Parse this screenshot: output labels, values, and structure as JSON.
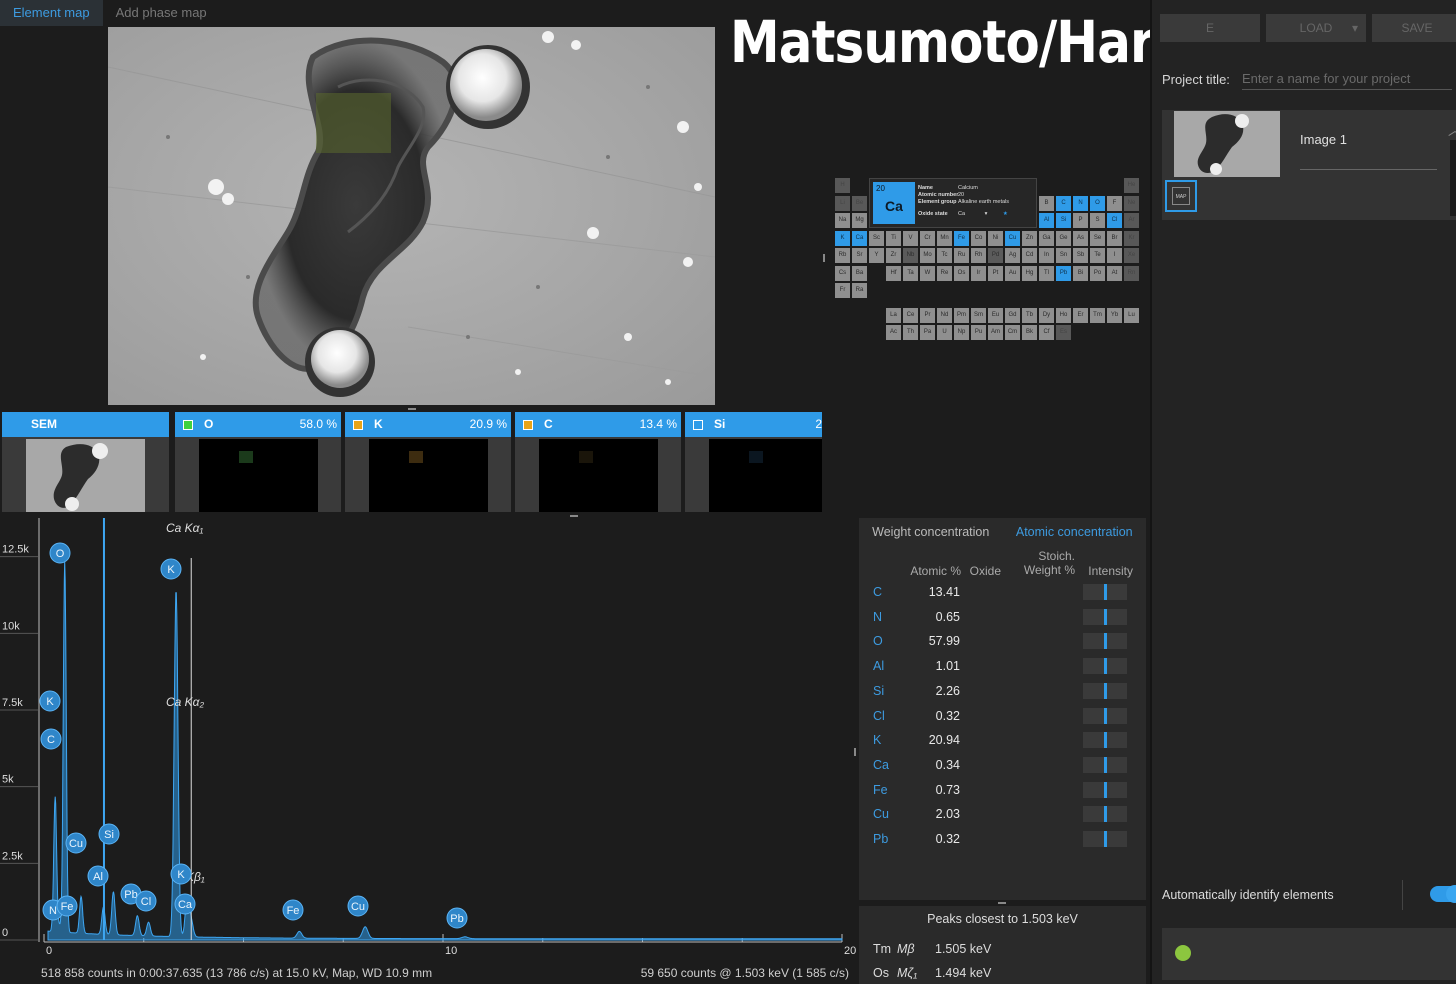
{
  "tabs": [
    "Element map",
    "Add phase map"
  ],
  "overlay_title": "Matsumoto/Harris/Greenyer",
  "periodic_table": {
    "tooltip": {
      "number": "20",
      "symbol": "Ca",
      "rows": [
        {
          "label": "Name",
          "value": "Calcium"
        },
        {
          "label": "Atomic number",
          "value": "20"
        },
        {
          "label": "Element group",
          "value": "Alkaline earth metals"
        },
        {
          "label": "Oxide state",
          "value": "Ca"
        }
      ]
    },
    "selected": [
      "C",
      "N",
      "O",
      "Al",
      "Si",
      "Cl",
      "K",
      "Ca",
      "Fe",
      "Cu",
      "Pb"
    ]
  },
  "tiles": [
    {
      "name": "SEM",
      "percent": "",
      "swatch": ""
    },
    {
      "name": "O",
      "percent": "58.0 %",
      "swatch": "#3fd13f"
    },
    {
      "name": "K",
      "percent": "20.9 %",
      "swatch": "#e8a317"
    },
    {
      "name": "C",
      "percent": "13.4 %",
      "swatch": "#e8a317"
    },
    {
      "name": "Si",
      "percent": "2",
      "swatch": "#2f9be8"
    }
  ],
  "spectrum": {
    "y_ticks": [
      "12.5k",
      "10k",
      "7.5k",
      "5k",
      "2.5k",
      "0"
    ],
    "x_ticks": [
      "0",
      "10",
      "20"
    ],
    "line_labels": [
      {
        "text": "Ca Kα₁"
      },
      {
        "text": "Ca Kα₂"
      },
      {
        "text": "a Kβ₁"
      }
    ],
    "peak_markers": [
      "O",
      "K",
      "K",
      "C",
      "Cu",
      "Si",
      "Al",
      "Pb",
      "Cl",
      "K",
      "Ca",
      "N",
      "Fe",
      "Fe",
      "Cu",
      "Pb"
    ],
    "status_left": "518 858 counts in 0:00:37.635 (13 786 c/s) at 15.0 kV, Map, WD 10.9 mm",
    "status_right": "59 650 counts @ 1.503 keV (1 585 c/s)"
  },
  "chart_data": {
    "type": "line",
    "title": "",
    "xlabel": "",
    "ylabel": "",
    "xlim": [
      0,
      20
    ],
    "ylim": [
      0,
      13500
    ],
    "x_unit": "keV",
    "peaks": [
      {
        "x": 0.28,
        "y": 4400,
        "element": "C"
      },
      {
        "x": 0.39,
        "y": 200,
        "element": "N"
      },
      {
        "x": 0.52,
        "y": 12100,
        "element": "O"
      },
      {
        "x": 0.93,
        "y": 1200,
        "element": "Cu"
      },
      {
        "x": 1.49,
        "y": 900,
        "element": "Al"
      },
      {
        "x": 1.74,
        "y": 1400,
        "element": "Si"
      },
      {
        "x": 2.34,
        "y": 650,
        "element": "Pb"
      },
      {
        "x": 2.62,
        "y": 450,
        "element": "Cl"
      },
      {
        "x": 3.31,
        "y": 11300,
        "element": "K"
      },
      {
        "x": 3.59,
        "y": 1300,
        "element": "K"
      },
      {
        "x": 3.69,
        "y": 500,
        "element": "Ca"
      },
      {
        "x": 6.4,
        "y": 220,
        "element": "Fe"
      },
      {
        "x": 8.05,
        "y": 380,
        "element": "Cu"
      },
      {
        "x": 10.55,
        "y": 60,
        "element": "Pb"
      }
    ]
  },
  "concentration": {
    "tabs": [
      "Weight concentration",
      "Atomic concentration"
    ],
    "headers": {
      "atomic": "Atomic %",
      "oxide": "Oxide",
      "stoich": "Stoich.\nWeight %",
      "intensity": "Intensity"
    },
    "rows": [
      {
        "el": "C",
        "value": "13.41",
        "intensity": 0.5
      },
      {
        "el": "N",
        "value": "0.65",
        "intensity": 0.5
      },
      {
        "el": "O",
        "value": "57.99",
        "intensity": 0.5
      },
      {
        "el": "Al",
        "value": "1.01",
        "intensity": 0.5
      },
      {
        "el": "Si",
        "value": "2.26",
        "intensity": 0.5
      },
      {
        "el": "Cl",
        "value": "0.32",
        "intensity": 0.5
      },
      {
        "el": "K",
        "value": "20.94",
        "intensity": 0.5
      },
      {
        "el": "Ca",
        "value": "0.34",
        "intensity": 0.5
      },
      {
        "el": "Fe",
        "value": "0.73",
        "intensity": 0.5
      },
      {
        "el": "Cu",
        "value": "2.03",
        "intensity": 0.5
      },
      {
        "el": "Pb",
        "value": "0.32",
        "intensity": 0.5
      }
    ]
  },
  "peaks_panel": {
    "title": "Peaks closest to 1.503 keV",
    "rows": [
      {
        "el": "Tm",
        "line": "Mβ",
        "energy": "1.505 keV"
      },
      {
        "el": "Os",
        "line": "Mζ₁",
        "energy": "1.494 keV"
      }
    ]
  },
  "right_panel": {
    "buttons": [
      "E",
      "LOAD",
      "SAVE"
    ],
    "project_label": "Project title:",
    "project_placeholder": "Enter a name for your project",
    "image_name": "Image 1",
    "map_badge": "MAP",
    "auto_identify": "Automatically identify elements"
  },
  "colors": {
    "accent": "#2f9be8",
    "status_ok": "#8cc63f"
  }
}
